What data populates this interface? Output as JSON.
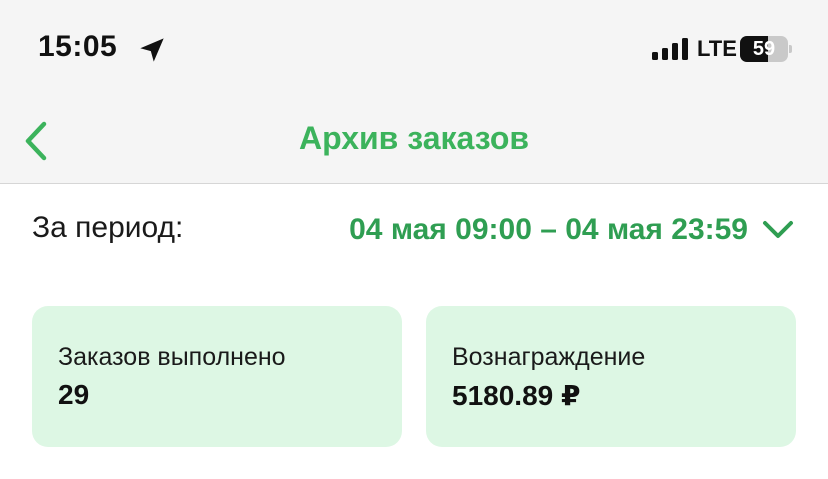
{
  "status_bar": {
    "time": "15:05",
    "network": "LTE",
    "battery_level": "59",
    "battery_fraction": 0.59,
    "icons": [
      "location-arrow-icon",
      "signal-bars-icon"
    ]
  },
  "nav": {
    "title": "Архив заказов",
    "back_icon": "chevron-left-icon"
  },
  "period": {
    "label": "За период:",
    "value": "04 мая 09:00 – 04 мая 23:59",
    "dropdown_icon": "chevron-down-icon"
  },
  "stats": [
    {
      "label": "Заказов выполнено",
      "value": "29"
    },
    {
      "label": "Вознаграждение",
      "value": "5180.89 ₽"
    }
  ],
  "colors": {
    "accent": "#3cb35c",
    "period_text": "#2f9e52",
    "card_background": "#ddf7e4",
    "header_background": "#f5f5f5"
  }
}
